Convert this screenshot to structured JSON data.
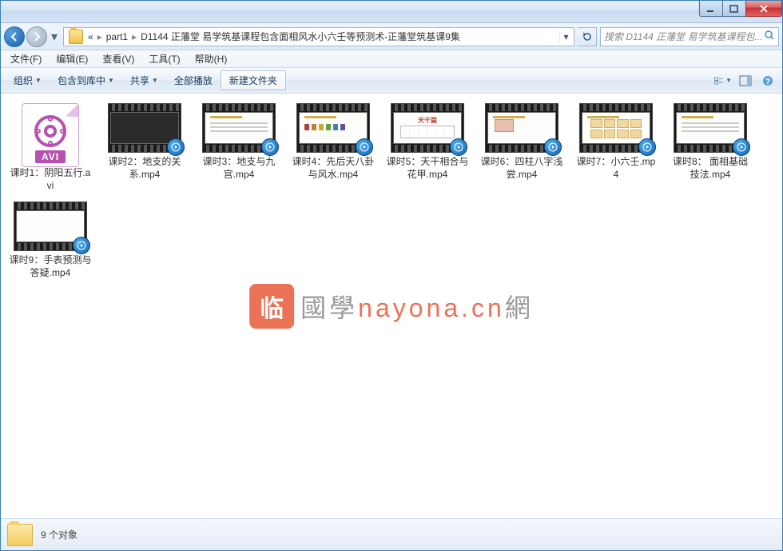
{
  "titlebar": {},
  "nav": {
    "crumb_prefix": "«",
    "crumb1": "part1",
    "crumb2": "D1144 正藩堂 易学筑基课程包含面相风水小六壬等预测术-正藩堂筑基课9集",
    "search_placeholder": "搜索 D1144 正藩堂 易学筑基课程包..."
  },
  "menubar": {
    "file": "文件(F)",
    "edit": "编辑(E)",
    "view": "查看(V)",
    "tools": "工具(T)",
    "help": "帮助(H)"
  },
  "toolbar": {
    "organize": "组织",
    "include": "包含到库中",
    "share": "共享",
    "playall": "全部播放",
    "newfolder": "新建文件夹"
  },
  "files": [
    {
      "name": "课时1：阴阳五行.avi",
      "type": "avi"
    },
    {
      "name": "课时2：地支的关系.mp4",
      "type": "mp4",
      "variant": "dark"
    },
    {
      "name": "课时3：地支与九宫.mp4",
      "type": "mp4",
      "variant": "light"
    },
    {
      "name": "课时4：先后天八卦与风水.mp4",
      "type": "mp4",
      "variant": "f4"
    },
    {
      "name": "课时5：天干相合与花甲.mp4",
      "type": "mp4",
      "variant": "f5",
      "title_text": "天干篇"
    },
    {
      "name": "课时6：四柱八字浅尝.mp4",
      "type": "mp4",
      "variant": "f6"
    },
    {
      "name": "课时7：小六壬.mp4",
      "type": "mp4",
      "variant": "f7"
    },
    {
      "name": "课时8： 面相基础技法.mp4",
      "type": "mp4",
      "variant": "light"
    },
    {
      "name": "课时9：手表预测与答疑.mp4",
      "type": "mp4",
      "variant": "blank"
    }
  ],
  "watermark": {
    "seal": "临",
    "text_pre": "國學",
    "text_hl": "nayona.cn",
    "text_post": "網"
  },
  "status": {
    "text": "9 个对象"
  },
  "avi_badge": "AVI"
}
